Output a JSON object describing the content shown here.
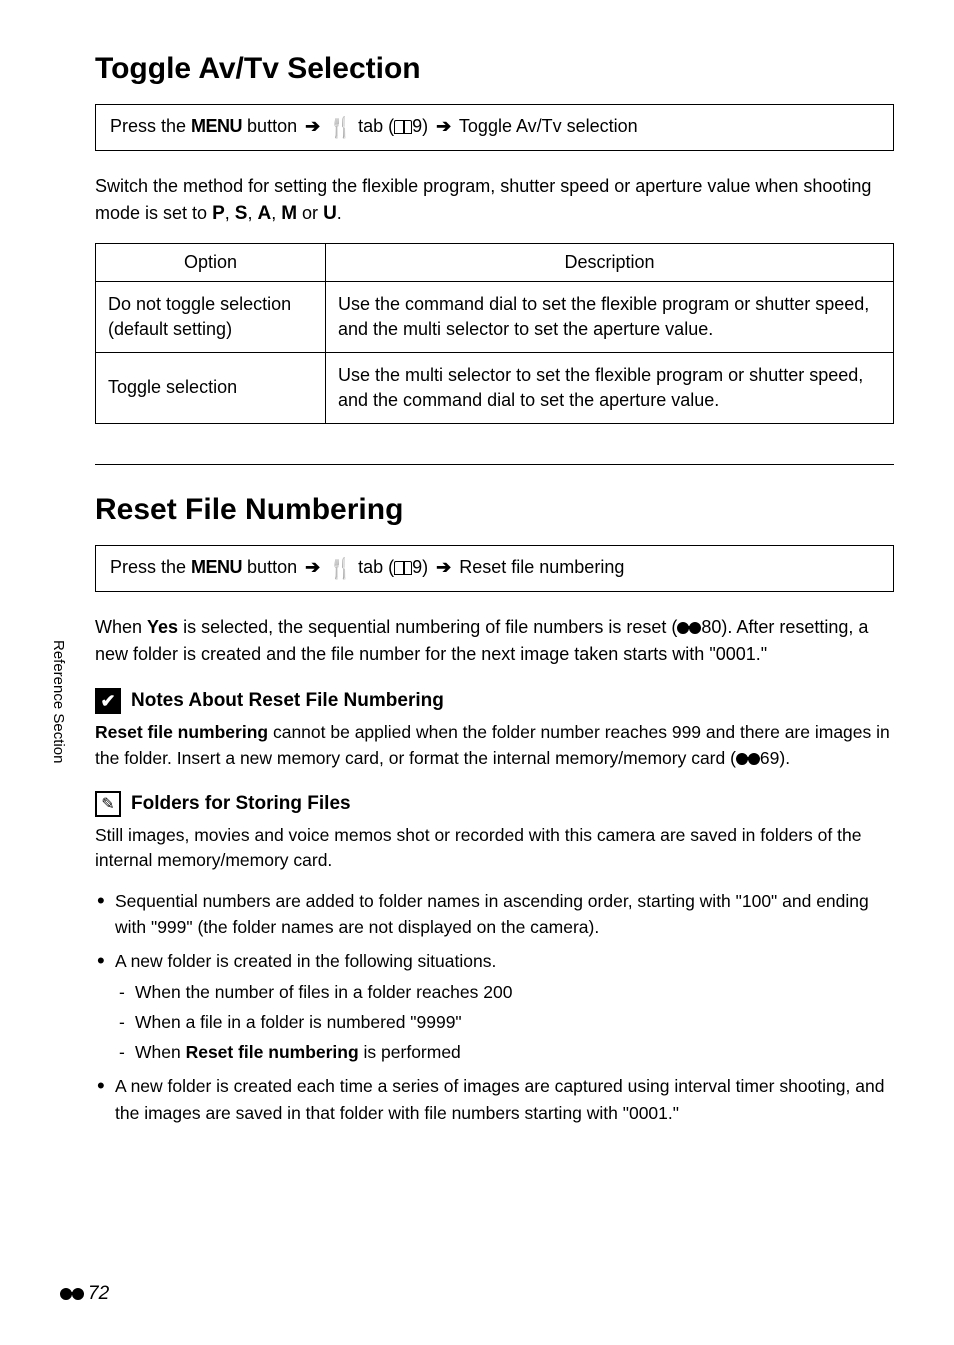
{
  "sidebar": {
    "label": "Reference Section"
  },
  "section1": {
    "heading": "Toggle Av/Tv Selection",
    "nav_prefix": "Press the ",
    "nav_menu": "MENU",
    "nav_button": " button ",
    "nav_tab": " tab (",
    "nav_pageref": "9",
    "nav_close": ") ",
    "nav_item": " Toggle Av/Tv selection",
    "intro_pre": "Switch the method for setting the flexible program, shutter speed or aperture value when shooting mode is set to ",
    "intro_modes": "P, S, A, M or U",
    "intro_post": ".",
    "table": {
      "header_option": "Option",
      "header_description": "Description",
      "rows": [
        {
          "option": "Do not toggle selection (default setting)",
          "description": "Use the command dial to set the flexible program or shutter speed, and the multi selector to set the aperture value."
        },
        {
          "option": "Toggle selection",
          "description": "Use the multi selector to set the flexible program or shutter speed, and the command dial to set the aperture value."
        }
      ]
    }
  },
  "section2": {
    "heading": "Reset File Numbering",
    "nav_prefix": "Press the ",
    "nav_menu": "MENU",
    "nav_button": " button ",
    "nav_tab": " tab (",
    "nav_pageref": "9",
    "nav_close": ") ",
    "nav_item": " Reset file numbering",
    "body1_pre": "When ",
    "body1_yes": "Yes",
    "body1_mid": " is selected, the sequential numbering of file numbers is reset (",
    "body1_ref": "80",
    "body1_post": "). After resetting, a new folder is created and the file number for the next image taken starts with \"0001.\"",
    "note1": {
      "title": "Notes About Reset File Numbering",
      "body_pre": "Reset file numbering",
      "body_mid": " cannot be applied when the folder number reaches 999 and there are images in the folder. Insert a new memory card, or format the internal memory/memory card (",
      "body_ref": "69",
      "body_post": ")."
    },
    "note2": {
      "title": "Folders for Storing Files",
      "intro": "Still images, movies and voice memos shot or recorded with this camera are saved in folders of the internal memory/memory card.",
      "bullets": [
        {
          "text": "Sequential numbers are added to folder names in ascending order, starting with \"100\" and ending with \"999\" (the folder names are not displayed on the camera)."
        },
        {
          "text": "A new folder is created in the following situations.",
          "subs": [
            "When the number of files in a folder reaches 200",
            "When a file in a folder is numbered \"9999\"",
            {
              "pre": "When ",
              "bold": "Reset file numbering",
              "post": " is performed"
            }
          ]
        },
        {
          "text": "A new folder is created each time a series of images are captured using interval timer shooting, and the images are saved in that folder with file numbers starting with \"0001.\""
        }
      ]
    }
  },
  "footer": {
    "page": "72"
  }
}
